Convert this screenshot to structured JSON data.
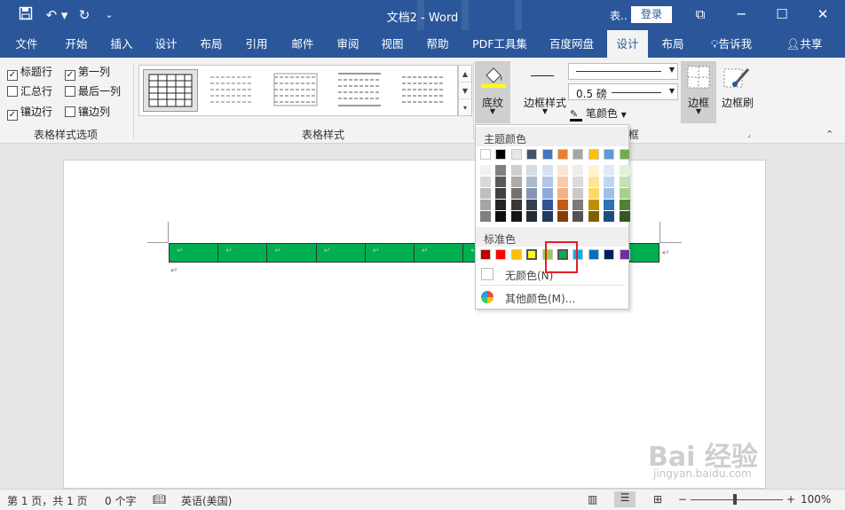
{
  "title_bar": {
    "title": "文档2  -  Word",
    "account_short": "表..",
    "login": "登录",
    "quick_access": [
      "save-icon",
      "undo-icon",
      "redo-icon",
      "customize-icon"
    ]
  },
  "tabs": [
    {
      "label": "文件"
    },
    {
      "label": "开始"
    },
    {
      "label": "插入"
    },
    {
      "label": "设计"
    },
    {
      "label": "布局"
    },
    {
      "label": "引用"
    },
    {
      "label": "邮件"
    },
    {
      "label": "审阅"
    },
    {
      "label": "视图"
    },
    {
      "label": "帮助"
    },
    {
      "label": "PDF工具集"
    },
    {
      "label": "百度网盘"
    },
    {
      "label": "设计"
    },
    {
      "label": "布局"
    },
    {
      "label": "告诉我"
    },
    {
      "label": "共享"
    }
  ],
  "ribbon": {
    "style_options": {
      "label": "表格样式选项",
      "items": [
        {
          "label": "标题行",
          "checked": true
        },
        {
          "label": "第一列",
          "checked": true
        },
        {
          "label": "汇总行",
          "checked": false
        },
        {
          "label": "最后一列",
          "checked": false
        },
        {
          "label": "镶边行",
          "checked": true
        },
        {
          "label": "镶边列",
          "checked": false
        }
      ]
    },
    "table_styles_label": "表格样式",
    "shading": "底纹",
    "border_style": "边框样式",
    "line_weight": "0.5 磅",
    "pen_color": "笔颜色",
    "borders": "边框",
    "border_painter": "边框刷",
    "borders_group_label": "框"
  },
  "shading_menu": {
    "theme_colors_label": "主题颜色",
    "standard_colors_label": "标准色",
    "no_color": "无颜色(N)",
    "more_colors": "其他颜色(M)...",
    "theme_top": [
      "#ffffff",
      "#000000",
      "#e7e6e6",
      "#44546a",
      "#4472c4",
      "#ed7d31",
      "#a5a5a5",
      "#ffc000",
      "#5b9bd5",
      "#70ad47"
    ],
    "theme_shades": [
      [
        "#f2f2f2",
        "#d9d9d9",
        "#bfbfbf",
        "#a6a6a6",
        "#808080"
      ],
      [
        "#808080",
        "#595959",
        "#404040",
        "#262626",
        "#0d0d0d"
      ],
      [
        "#d0cece",
        "#aeabab",
        "#757171",
        "#3a3838",
        "#171616"
      ],
      [
        "#d6dce4",
        "#acb9ca",
        "#8496b0",
        "#333f4f",
        "#222a35"
      ],
      [
        "#d9e2f3",
        "#b4c6e7",
        "#8eaadb",
        "#2f5496",
        "#1f3864"
      ],
      [
        "#fbe5d5",
        "#f7cbac",
        "#f4b183",
        "#c55a11",
        "#833c0b"
      ],
      [
        "#ededed",
        "#dbdbdb",
        "#c9c9c9",
        "#7b7b7b",
        "#525252"
      ],
      [
        "#fff2cc",
        "#ffe599",
        "#ffd966",
        "#bf8f00",
        "#7f6000"
      ],
      [
        "#deebf6",
        "#bdd7ee",
        "#9cc3e5",
        "#2e75b5",
        "#1e4e79"
      ],
      [
        "#e2efd9",
        "#c5e0b3",
        "#a8d08d",
        "#538135",
        "#375623"
      ]
    ],
    "standard": [
      "#c00000",
      "#ff0000",
      "#ffc000",
      "#ffff00",
      "#92d050",
      "#00b050",
      "#00b0f0",
      "#0070c0",
      "#002060",
      "#7030a0"
    ]
  },
  "document": {
    "table_cells": 10,
    "fill_color": "#00b050"
  },
  "status": {
    "page": "第 1 页，共 1 页",
    "words": "0 个字",
    "language": "英语(美国)",
    "zoom": "100%"
  },
  "watermark": {
    "text": "Bai 经验",
    "sub": "jingyan.baidu.com"
  }
}
